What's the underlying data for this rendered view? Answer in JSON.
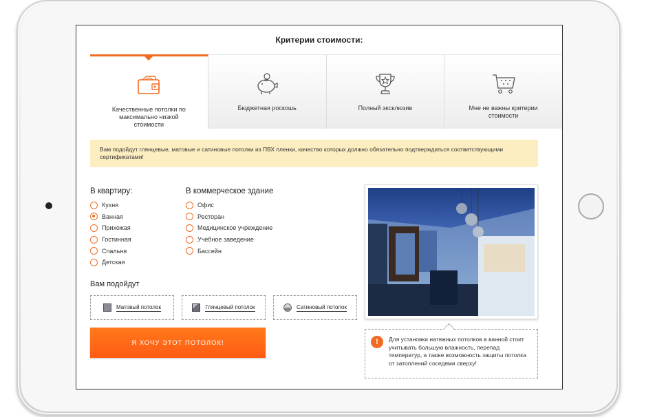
{
  "page": {
    "title": "Критерии стоимости:"
  },
  "tabs": [
    {
      "label": "Качественные потолки по максимально низкой стоимости",
      "icon": "wallet-icon",
      "active": true
    },
    {
      "label": "Бюджетная роскошь",
      "icon": "piggy-bank-icon",
      "active": false
    },
    {
      "label": "Полный эксклюзив",
      "icon": "trophy-icon",
      "active": false
    },
    {
      "label": "Мне не важны критерии стоимости",
      "icon": "cart-icon",
      "active": false
    }
  ],
  "note": "Вам подойдут глянцевые, матовые и сатиновые потолки из ПВХ пленки, качество которых должно обязательно подтверждаться соответствующими сертификатами!",
  "apartment": {
    "title": "В квартиру:",
    "options": [
      "Кухня",
      "Ванная",
      "Прихожая",
      "Гостинная",
      "Спальня",
      "Детская"
    ],
    "selected": "Ванная"
  },
  "commercial": {
    "title": "В коммерческое здание",
    "options": [
      "Офис",
      "Ресторан",
      "Медицинское учреждение",
      "Учебное заведение",
      "Бассейн"
    ]
  },
  "suits": {
    "title": "Вам подойдут",
    "items": [
      {
        "label": "Матовый потолок",
        "icon": "matte-swatch-icon"
      },
      {
        "label": "Глянцевый потолок",
        "icon": "glossy-swatch-icon"
      },
      {
        "label": "Сатиновый потолок",
        "icon": "satin-swatch-icon"
      }
    ]
  },
  "cta": {
    "label": "Я ХОЧУ ЭТОТ ПОТОЛОК!"
  },
  "info": {
    "text": "Для установки натяжных потолков в ванной стоит учитывать большую влажность, перепад температур, а также возможность защиты потолка от затоплений соседями сверху!"
  },
  "colors": {
    "accent": "#f26b21",
    "note_bg": "#fdeec1"
  }
}
